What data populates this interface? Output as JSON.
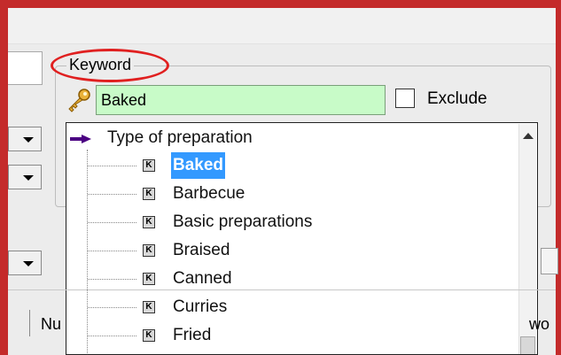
{
  "keyword_group": {
    "title": "Keyword",
    "input_value": "Baked",
    "exclude_label": "Exclude",
    "exclude_checked": false
  },
  "tree": {
    "root_label": "Type of preparation",
    "badge_letter": "K",
    "items": [
      "Baked",
      "Barbecue",
      "Basic preparations",
      "Braised",
      "Canned",
      "Curries",
      "Fried"
    ],
    "selected_item": "Baked"
  },
  "background_columns": {
    "left_header": "Nu",
    "right_header": "wo"
  },
  "colors": {
    "annotation_red": "#e02020",
    "input_green": "#c8fbc8",
    "selection_blue": "#3399ff",
    "frame_red": "#c42b2b"
  }
}
